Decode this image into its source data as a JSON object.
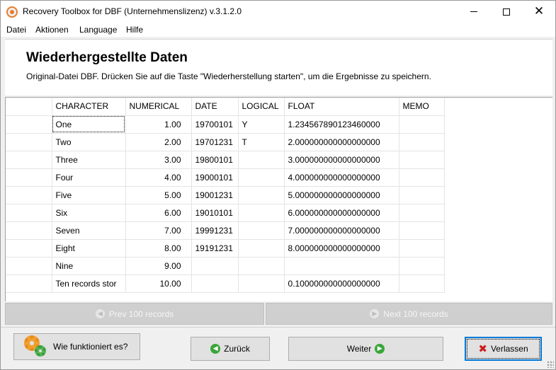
{
  "window": {
    "title": "Recovery Toolbox for DBF (Unternehmenslizenz) v.3.1.2.0",
    "min_glyph": "",
    "max_glyph": "",
    "close_glyph": "✕"
  },
  "menu": {
    "items": [
      "Datei",
      "Aktionen",
      "Language",
      "Hilfe"
    ]
  },
  "header": {
    "title": "Wiederhergestellte Daten",
    "subtitle": "Original-Datei DBF. Drücken Sie auf die Taste \"Wiederherstellung starten\", um die Ergebnisse zu speichern."
  },
  "grid": {
    "columns": [
      "",
      "CHARACTER",
      "NUMERICAL",
      "DATE",
      "LOGICAL",
      "FLOAT",
      "MEMO"
    ],
    "rows": [
      [
        "",
        "One",
        "1.00",
        "19700101",
        "Y",
        "1.234567890123460000",
        ""
      ],
      [
        "",
        "Two",
        "2.00",
        "19701231",
        "T",
        "2.000000000000000000",
        ""
      ],
      [
        "",
        "Three",
        "3.00",
        "19800101",
        "",
        "3.000000000000000000",
        ""
      ],
      [
        "",
        "Four",
        "4.00",
        "19000101",
        "",
        "4.000000000000000000",
        ""
      ],
      [
        "",
        "Five",
        "5.00",
        "19001231",
        "",
        "5.000000000000000000",
        ""
      ],
      [
        "",
        "Six",
        "6.00",
        "19010101",
        "",
        "6.000000000000000000",
        ""
      ],
      [
        "",
        "Seven",
        "7.00",
        "19991231",
        "",
        "7.000000000000000000",
        ""
      ],
      [
        "",
        "Eight",
        "8.00",
        "19191231",
        "",
        "8.000000000000000000",
        ""
      ],
      [
        "",
        "Nine",
        "9.00",
        "",
        "",
        "",
        ""
      ],
      [
        "",
        "Ten records stor",
        "10.00",
        "",
        "",
        "0.100000000000000000",
        ""
      ]
    ]
  },
  "nav": {
    "prev_label": "Prev 100 records",
    "next_label": "Next 100 records"
  },
  "buttons": {
    "help_label": "Wie funktioniert es?",
    "back_label": "Zurück",
    "next_label": "Weiter",
    "exit_label": "Verlassen"
  },
  "colors": {
    "accent": "#0078d7",
    "gear_orange": "#f0a030",
    "gear_green": "#55b455",
    "arrow_green": "#3aa63a",
    "exit_red": "#c8201e"
  }
}
